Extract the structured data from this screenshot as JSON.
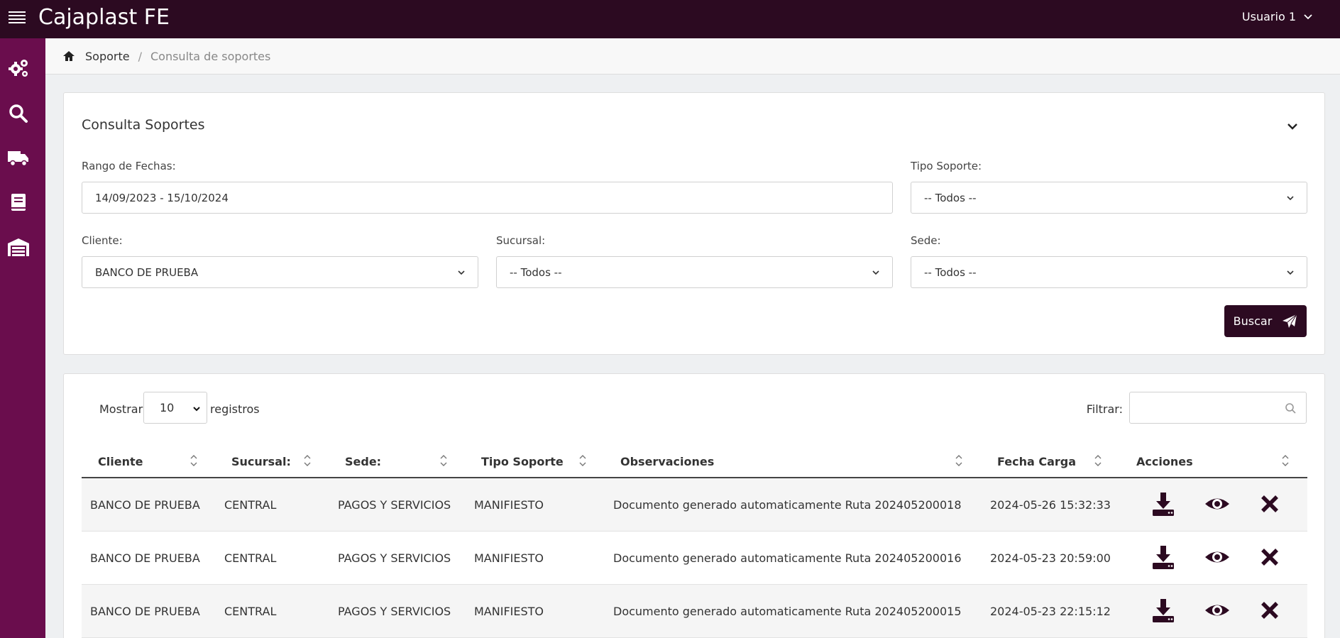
{
  "app": {
    "title": "Cajaplast FE",
    "user": "Usuario 1"
  },
  "sidebar": {
    "items": [
      {
        "icon": "gears-icon"
      },
      {
        "icon": "search-icon"
      },
      {
        "icon": "truck-icon"
      },
      {
        "icon": "book-icon"
      },
      {
        "icon": "warehouse-icon"
      }
    ]
  },
  "breadcrumb": {
    "home": "Soporte",
    "current": "Consulta de soportes"
  },
  "filters": {
    "title": "Consulta Soportes",
    "date_label": "Rango de Fechas:",
    "date_value": "14/09/2023 - 15/10/2024",
    "tipo_label": "Tipo Soporte:",
    "tipo_value": "-- Todos --",
    "cliente_label": "Cliente:",
    "cliente_value": "BANCO DE PRUEBA",
    "sucursal_label": "Sucursal:",
    "sucursal_value": "-- Todos --",
    "sede_label": "Sede:",
    "sede_value": "-- Todos --",
    "buscar_label": "Buscar"
  },
  "table": {
    "show_label": "Mostrar",
    "page_size": "10",
    "records_label": "registros",
    "filter_label": "Filtrar:",
    "columns": [
      "Cliente",
      "Sucursal:",
      "Sede:",
      "Tipo Soporte",
      "Observaciones",
      "Fecha Carga",
      "Acciones"
    ],
    "rows": [
      [
        "BANCO DE PRUEBA",
        "CENTRAL",
        "PAGOS Y SERVICIOS",
        "MANIFIESTO",
        "Documento generado automaticamente Ruta 202405200018",
        "2024-05-26 15:32:33"
      ],
      [
        "BANCO DE PRUEBA",
        "CENTRAL",
        "PAGOS Y SERVICIOS",
        "MANIFIESTO",
        "Documento generado automaticamente Ruta 202405200016",
        "2024-05-23 20:59:00"
      ],
      [
        "BANCO DE PRUEBA",
        "CENTRAL",
        "PAGOS Y SERVICIOS",
        "MANIFIESTO",
        "Documento generado automaticamente Ruta 202405200015",
        "2024-05-23 22:15:12"
      ]
    ]
  },
  "colors": {
    "topbar": "#2c0a21",
    "sidebar": "#6a0d4d",
    "accent": "#2c0a21"
  }
}
